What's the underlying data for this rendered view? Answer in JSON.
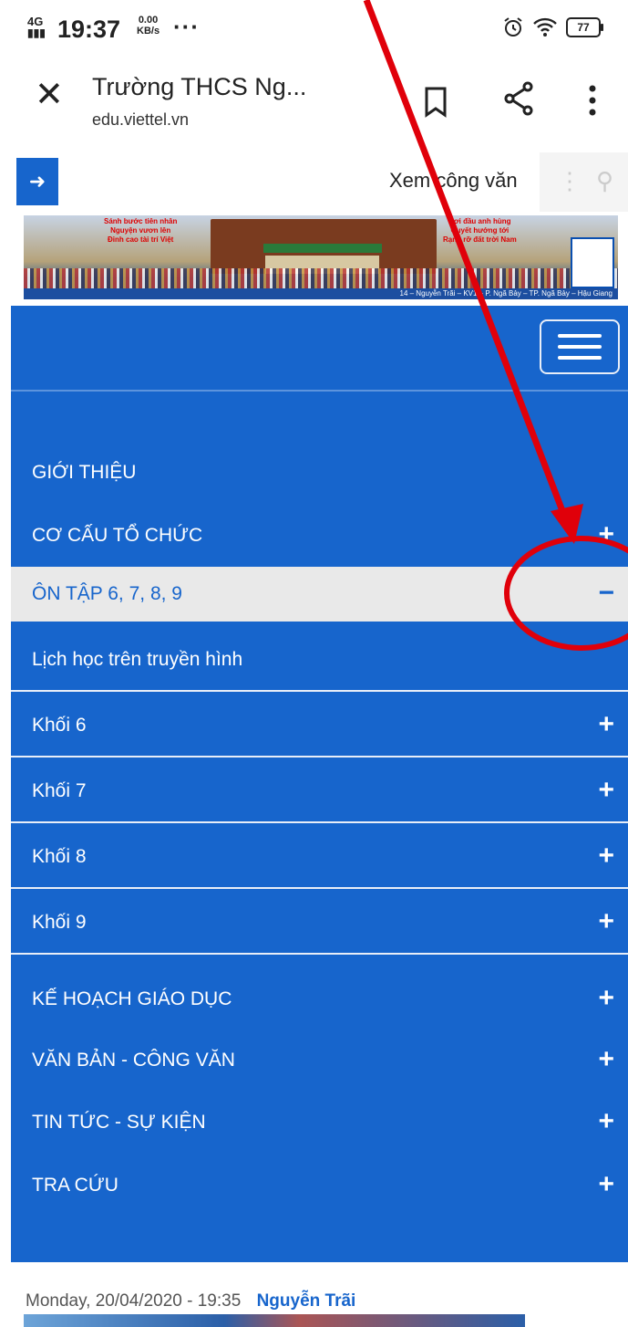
{
  "status_bar": {
    "signal": "4G",
    "time": "19:37",
    "speed_value": "0.00",
    "speed_unit": "KB/s",
    "more": "···",
    "battery": "77",
    "icons": [
      "alarm-icon",
      "wifi-icon",
      "battery-icon"
    ]
  },
  "browser": {
    "title": "Trường THCS Ng...",
    "url": "edu.viettel.vn",
    "close_glyph": "✕"
  },
  "site_header": {
    "login_glyph": "➜",
    "xem_cong_van": "Xem công văn"
  },
  "banner": {
    "left_text": "Sánh bước tiên nhân\nNguyện vươn lên\nĐỉnh cao tài trí Việt",
    "right_text": "Nơi đầu anh hùng\nQuyết hướng tới\nRạng rỡ đất trời Nam",
    "address": "14 – Nguyễn Trãi – KV1 – P. Ngã Bảy – TP. Ngã Bảy – Hậu Giang"
  },
  "menu": {
    "items": [
      {
        "label": "GIỚI THIỆU"
      },
      {
        "label": "CƠ CẤU TỔ CHỨC",
        "toggle": "+"
      },
      {
        "label": "ÔN TẬP 6, 7, 8, 9",
        "toggle": "−"
      },
      {
        "label": "KẾ HOẠCH GIÁO DỤC",
        "toggle": "+"
      },
      {
        "label": "VĂN BẢN - CÔNG VĂN",
        "toggle": "+"
      },
      {
        "label": "TIN TỨC - SỰ KIỆN",
        "toggle": "+"
      },
      {
        "label": "TRA CỨU",
        "toggle": "+"
      }
    ],
    "subitems": [
      {
        "label": "Lịch học trên truyền hình"
      },
      {
        "label": "Khối 6",
        "toggle": "+"
      },
      {
        "label": "Khối 7",
        "toggle": "+"
      },
      {
        "label": "Khối 8",
        "toggle": "+"
      },
      {
        "label": "Khối 9",
        "toggle": "+"
      }
    ]
  },
  "footer": {
    "date": "Monday, 20/04/2020 - 19:35",
    "author": "Nguyễn Trãi"
  },
  "colors": {
    "nav_blue": "#1765cc",
    "annotation_red": "#e0000a",
    "open_item_bg": "#e9e9e9"
  }
}
